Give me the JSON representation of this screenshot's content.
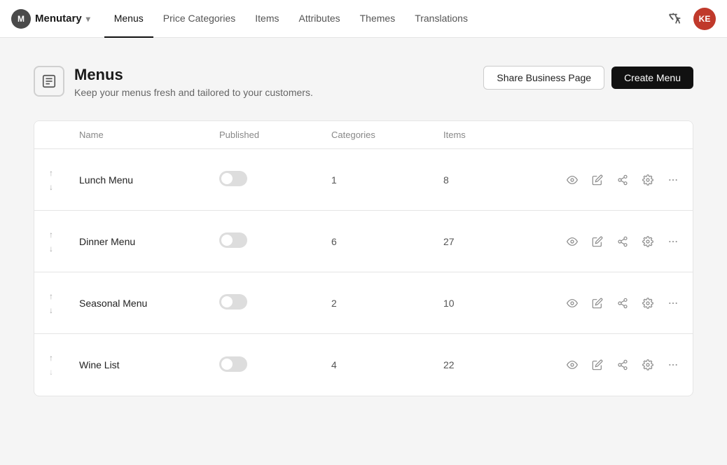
{
  "nav": {
    "brand_letter": "M",
    "brand_name": "Menutary",
    "items": [
      {
        "label": "Menus",
        "active": true
      },
      {
        "label": "Price Categories",
        "active": false
      },
      {
        "label": "Items",
        "active": false
      },
      {
        "label": "Attributes",
        "active": false
      },
      {
        "label": "Themes",
        "active": false
      },
      {
        "label": "Translations",
        "active": false
      }
    ],
    "user_initials": "KE"
  },
  "page": {
    "title": "Menus",
    "subtitle": "Keep your menus fresh and tailored to your customers.",
    "share_button": "Share Business Page",
    "create_button": "Create Menu"
  },
  "table": {
    "columns": [
      "",
      "Name",
      "Published",
      "Categories",
      "Items",
      ""
    ],
    "rows": [
      {
        "name": "Lunch Menu",
        "published": false,
        "categories": "1",
        "items": "8"
      },
      {
        "name": "Dinner Menu",
        "published": false,
        "categories": "6",
        "items": "27"
      },
      {
        "name": "Seasonal Menu",
        "published": false,
        "categories": "2",
        "items": "10"
      },
      {
        "name": "Wine List",
        "published": false,
        "categories": "4",
        "items": "22"
      }
    ]
  },
  "icons": {
    "eye": "👁",
    "edit": "✏",
    "share": "⤴",
    "gear": "⚙",
    "more": "⋯",
    "up_arrow": "↑",
    "down_arrow": "↓"
  }
}
